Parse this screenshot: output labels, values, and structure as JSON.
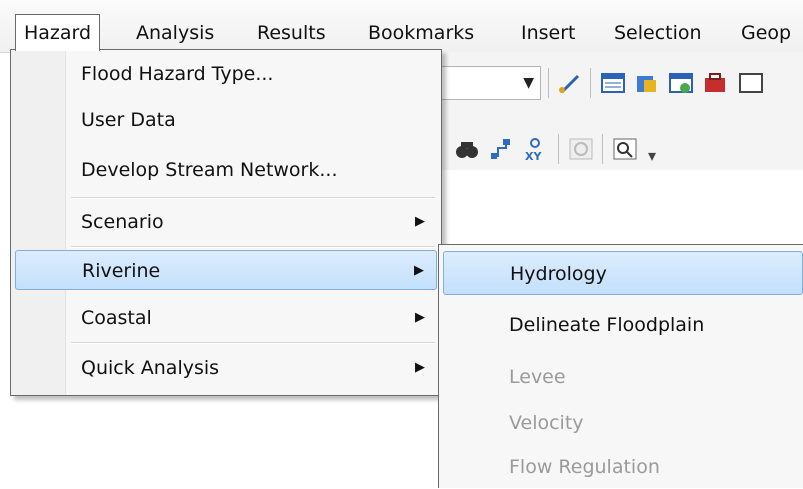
{
  "menubar": {
    "items": [
      "Hazard",
      "Analysis",
      "Results",
      "Bookmarks",
      "Insert",
      "Selection",
      "Geop"
    ]
  },
  "toolbar": {
    "icons": [
      "edit-tool-icon",
      "table-icon",
      "layer-icon",
      "window-icon",
      "toolbox-icon",
      "find-icon",
      "route-icon",
      "goto-xy-icon",
      "time-slider-icon",
      "zoom-window-icon"
    ]
  },
  "hazard_menu": {
    "items": [
      {
        "label": "Flood Hazard Type...",
        "has_submenu": false
      },
      {
        "label": "User Data",
        "has_submenu": false
      },
      {
        "label": "Develop Stream Network...",
        "has_submenu": false
      },
      {
        "label": "Scenario",
        "has_submenu": true
      },
      {
        "label": "Riverine",
        "has_submenu": true,
        "highlighted": true
      },
      {
        "label": "Coastal",
        "has_submenu": true
      },
      {
        "label": "Quick Analysis",
        "has_submenu": true
      }
    ]
  },
  "riverine_submenu": {
    "items": [
      {
        "label": "Hydrology",
        "enabled": true,
        "highlighted": true
      },
      {
        "label": "Delineate Floodplain",
        "enabled": true
      },
      {
        "label": "Levee",
        "enabled": false
      },
      {
        "label": "Velocity",
        "enabled": false
      },
      {
        "label": "Flow Regulation",
        "enabled": false
      }
    ]
  },
  "colors": {
    "highlight": "#c4e0fc",
    "highlight_border": "#84acdd",
    "disabled_text": "#9a9a9a"
  }
}
